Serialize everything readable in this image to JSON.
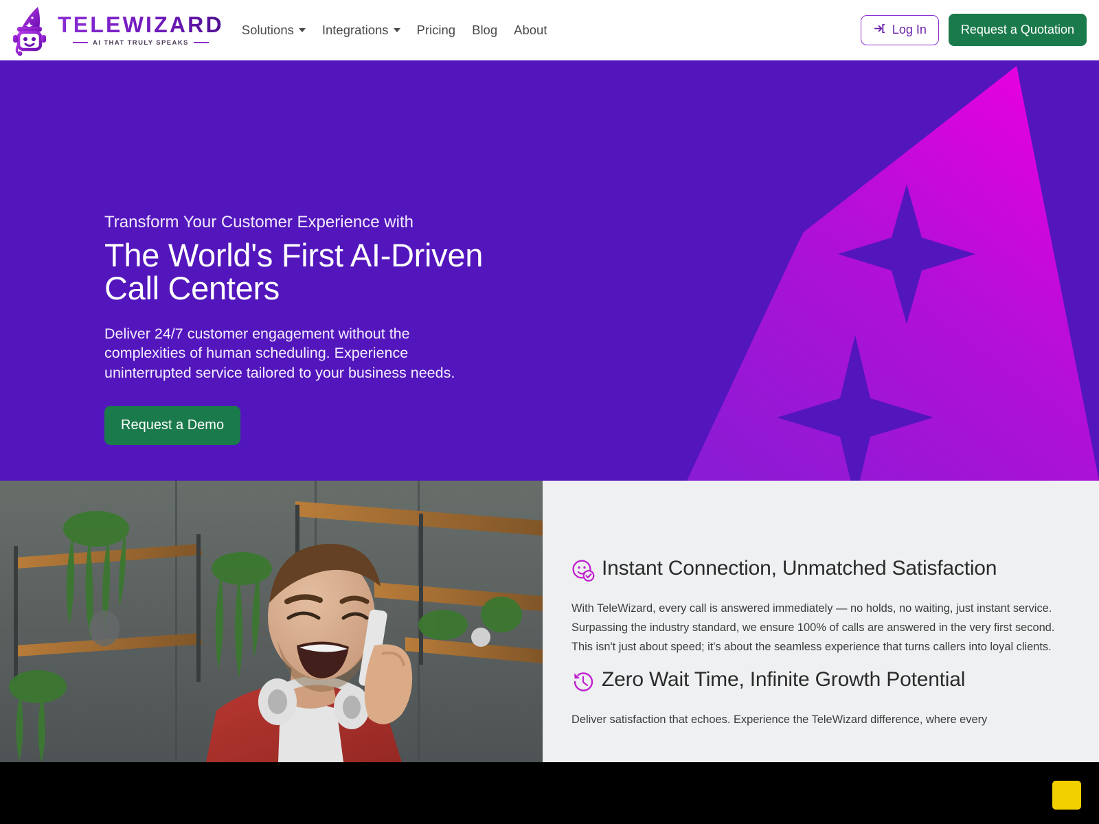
{
  "brand": {
    "name": "TELEWIZARD",
    "tagline": "AI THAT TRULY SPEAKS",
    "logo_icon": "wizard-robot-icon",
    "gradient_start": "#8b2fd4",
    "gradient_end": "#4d0f8f"
  },
  "nav": {
    "items": [
      {
        "label": "Solutions",
        "has_dropdown": true
      },
      {
        "label": "Integrations",
        "has_dropdown": true
      },
      {
        "label": "Pricing",
        "has_dropdown": false
      },
      {
        "label": "Blog",
        "has_dropdown": false
      },
      {
        "label": "About",
        "has_dropdown": false
      }
    ]
  },
  "header_actions": {
    "login_label": "Log In",
    "login_icon": "login-arrow-icon",
    "quote_label": "Request a Quotation",
    "quote_color": "#1b7a4b",
    "login_border_color": "#8b2fd4"
  },
  "hero": {
    "eyebrow": "Transform Your Customer Experience with",
    "title_line1": "The World's First AI-Driven",
    "title_line2": "Call Centers",
    "subtitle": "Deliver 24/7 customer engagement without the complexities of human scheduling. Experience uninterrupted service tailored to your business needs.",
    "cta_label": "Request a Demo",
    "background_color": "#5316bc",
    "art_color_start": "#e000e0",
    "art_color_end": "#8b1bd4",
    "art_icon": "wizard-hat-a-shape"
  },
  "photo": {
    "alt": "Smiling man talking on a phone with headphones around his neck in a modern office"
  },
  "features": [
    {
      "icon": "smiley-check-icon",
      "heading": "Instant Connection, Unmatched Satisfaction",
      "body": "With TeleWizard, every call is answered immediately — no holds, no waiting, just instant service. Surpassing the industry standard, we ensure 100% of calls are answered in the very first second. This isn't just about speed; it's about the seamless experience that turns callers into loyal clients."
    },
    {
      "icon": "clock-rewind-icon",
      "heading": "Zero Wait Time, Infinite Growth Potential",
      "body": "Deliver satisfaction that echoes. Experience the TeleWizard difference, where every"
    }
  ],
  "bottom_bar": {
    "background_color": "#000000",
    "chip_color": "#f2d000",
    "chip_name": "yellow-indicator-chip"
  }
}
